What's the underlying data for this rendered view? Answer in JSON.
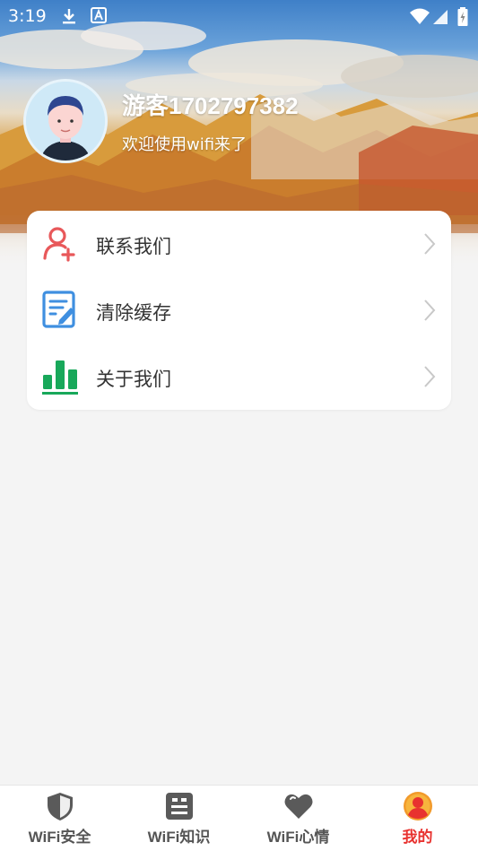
{
  "status_bar": {
    "time": "3:19",
    "icons": [
      "download-icon",
      "a-badge-icon",
      "wifi-icon",
      "signal-icon",
      "battery-icon"
    ]
  },
  "profile": {
    "username": "游客1702797382",
    "welcome": "欢迎使用wifi来了"
  },
  "menu": {
    "items": [
      {
        "label": "联系我们",
        "icon": "add-contact-icon",
        "color": "#e8585a"
      },
      {
        "label": "清除缓存",
        "icon": "edit-document-icon",
        "color": "#3f8fe0"
      },
      {
        "label": "关于我们",
        "icon": "bar-chart-icon",
        "color": "#18a85a"
      }
    ]
  },
  "bottom_nav": {
    "items": [
      {
        "label": "WiFi安全",
        "icon": "shield-icon"
      },
      {
        "label": "WiFi知识",
        "icon": "notebook-icon"
      },
      {
        "label": "WiFi心情",
        "icon": "heart-icon"
      },
      {
        "label": "我的",
        "icon": "profile-icon"
      }
    ],
    "active": "我的",
    "active_color": "#e8322f",
    "inactive_color": "#555555"
  }
}
